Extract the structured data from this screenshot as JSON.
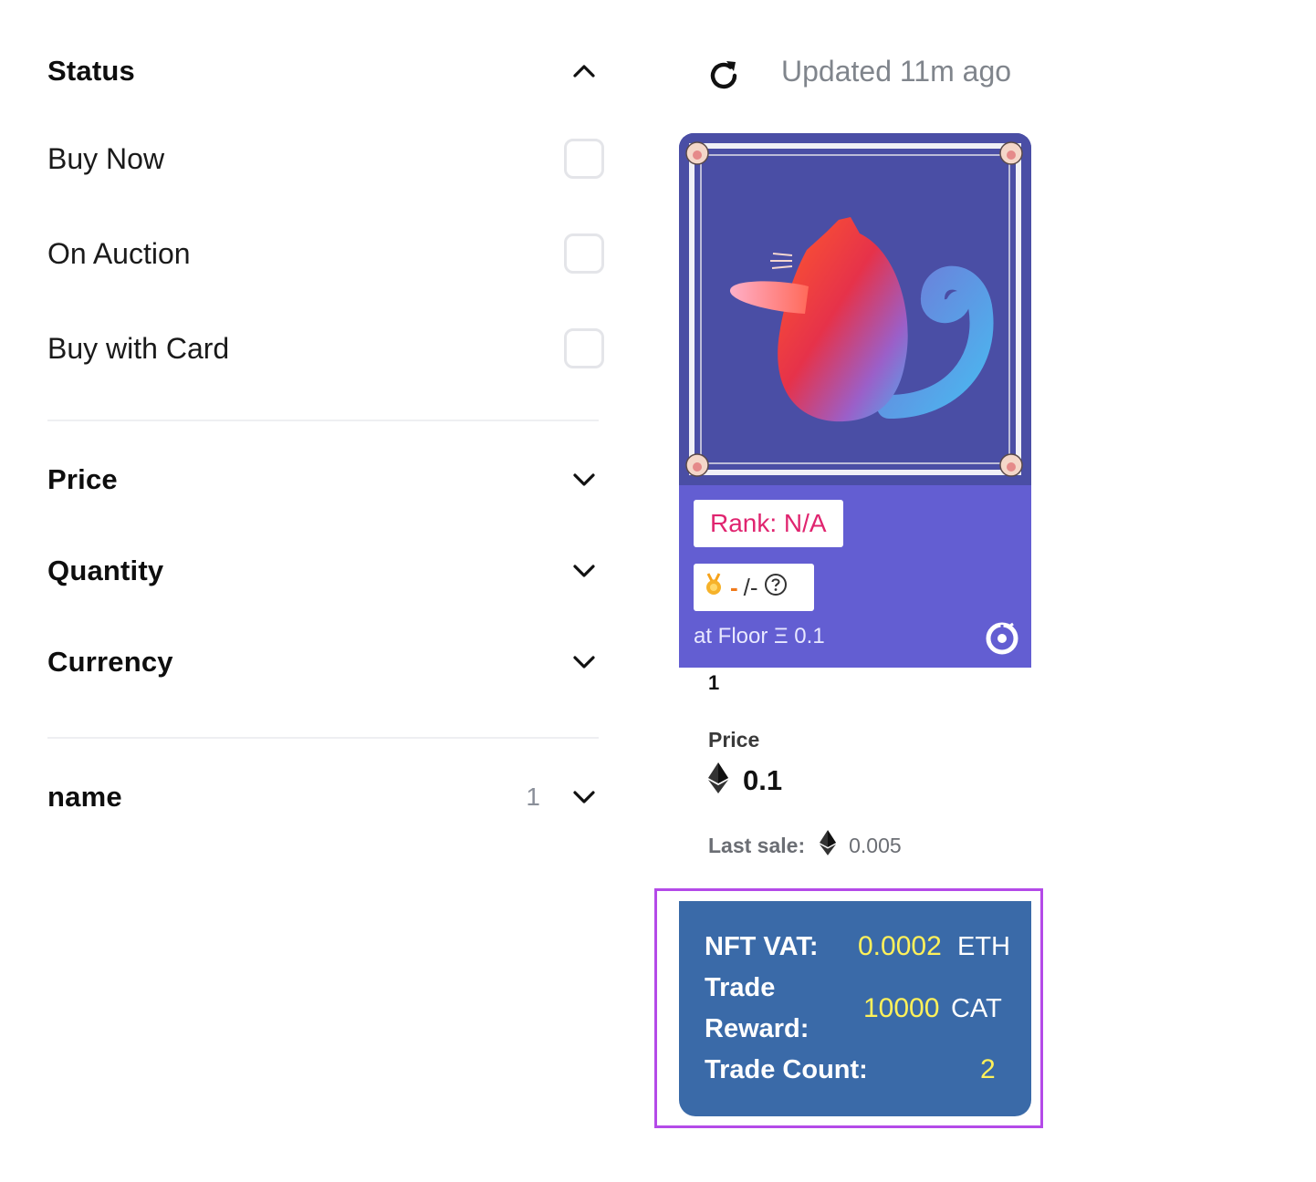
{
  "sidebar": {
    "status": {
      "title": "Status",
      "options": [
        "Buy Now",
        "On Auction",
        "Buy with Card"
      ]
    },
    "price": {
      "title": "Price"
    },
    "quantity": {
      "title": "Quantity"
    },
    "currency": {
      "title": "Currency"
    },
    "name": {
      "title": "name",
      "count": "1"
    }
  },
  "header": {
    "updated": "Updated 11m ago",
    "refresh_icon": "refresh-icon"
  },
  "card": {
    "rank": "Rank: N/A",
    "badge": {
      "dash": "-",
      "slash": "/-",
      "help_icon": "question-circle-icon",
      "medal_icon": "medal-icon"
    },
    "floor": "at Floor Ξ 0.1",
    "token_id": "1",
    "price_label": "Price",
    "price_value": "0.1",
    "last_sale_label": "Last sale:",
    "last_sale_value": "0.005"
  },
  "vat": {
    "nft_vat_label": "NFT VAT:",
    "nft_vat_value": "0.0002",
    "nft_vat_unit": "ETH",
    "trade_reward_label_1": "Trade",
    "trade_reward_label_2": "Reward:",
    "trade_reward_value": "10000",
    "trade_reward_unit": "CAT",
    "trade_count_label": "Trade Count:",
    "trade_count_value": "2"
  },
  "colors": {
    "card_purple": "#635ed2",
    "rank_pink": "#e0246f",
    "vat_blue": "#3a6aa8",
    "vat_yellow": "#fff15a",
    "highlight": "#b44ae8"
  }
}
